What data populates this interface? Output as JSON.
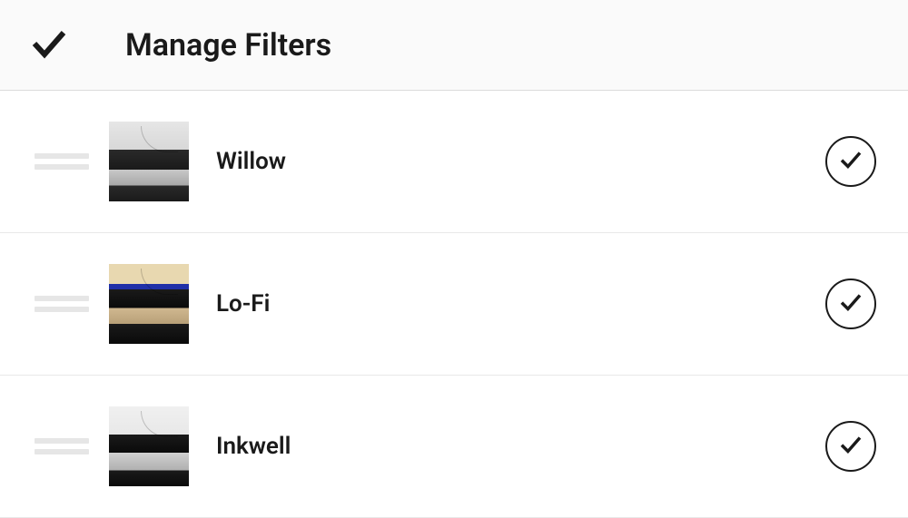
{
  "header": {
    "title": "Manage Filters"
  },
  "filters": [
    {
      "name": "Willow",
      "thumb_class": "thumb-willow"
    },
    {
      "name": "Lo-Fi",
      "thumb_class": "thumb-lofi"
    },
    {
      "name": "Inkwell",
      "thumb_class": "thumb-inkwell"
    }
  ]
}
